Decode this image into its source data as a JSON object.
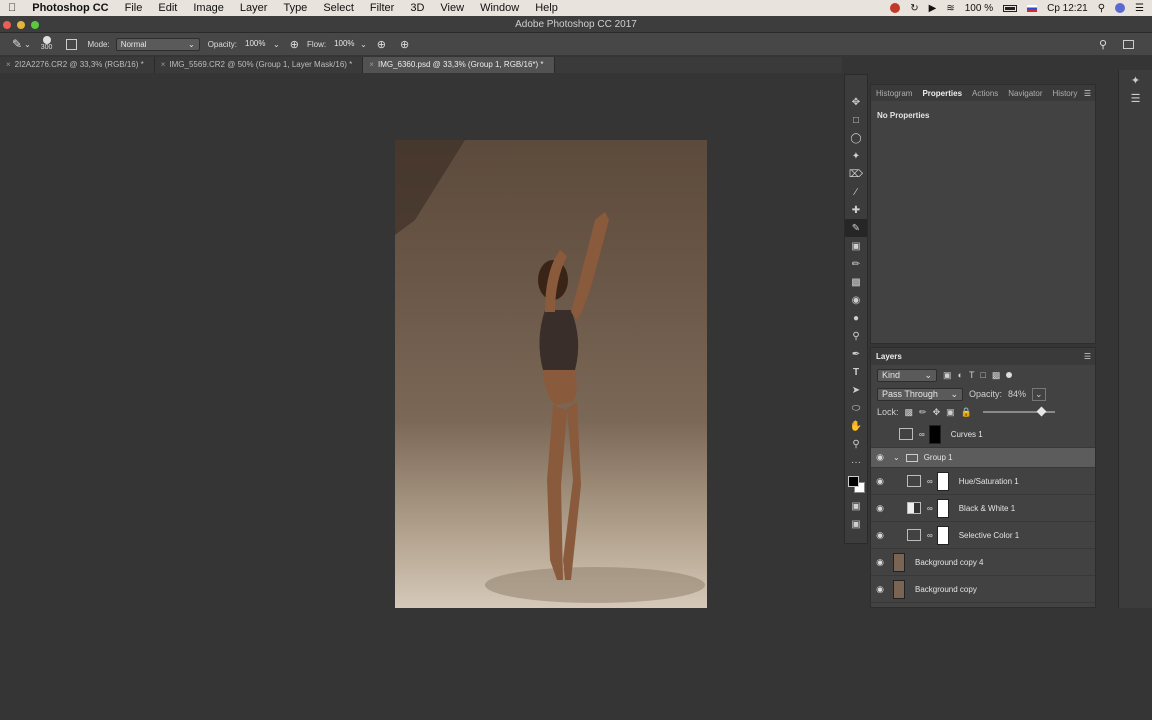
{
  "menubar": {
    "app": "Photoshop CC",
    "items": [
      "File",
      "Edit",
      "Image",
      "Layer",
      "Type",
      "Select",
      "Filter",
      "3D",
      "View",
      "Window",
      "Help"
    ],
    "battery": "100 %",
    "clock": "Ср 12:21"
  },
  "window": {
    "title": "Adobe Photoshop CC 2017"
  },
  "options": {
    "brush_size": "300",
    "mode_label": "Mode:",
    "mode_value": "Normal",
    "opacity_label": "Opacity:",
    "opacity_value": "100%",
    "flow_label": "Flow:",
    "flow_value": "100%"
  },
  "tabs": [
    {
      "label": "2I2A2276.CR2 @ 33,3% (RGB/16) *",
      "active": false
    },
    {
      "label": "IMG_5569.CR2 @ 50% (Group 1, Layer Mask/16) *",
      "active": false
    },
    {
      "label": "IMG_6360.psd @ 33,3% (Group 1, RGB/16*) *",
      "active": true
    }
  ],
  "properties_panel": {
    "tabs": [
      "Histogram",
      "Properties",
      "Actions",
      "Navigator",
      "History"
    ],
    "active_tab": "Properties",
    "content": "No Properties"
  },
  "layers_panel": {
    "title": "Layers",
    "filter_kind": "Kind",
    "blend_mode": "Pass Through",
    "opacity_label": "Opacity:",
    "opacity_value": "84%",
    "lock_label": "Lock:",
    "layers": [
      {
        "name": "Curves 1",
        "visible": false,
        "type": "adjustment",
        "mask": "black"
      },
      {
        "name": "Group 1",
        "visible": true,
        "type": "group",
        "selected": true
      },
      {
        "name": "Hue/Saturation 1",
        "visible": true,
        "type": "adjustment",
        "mask": "white"
      },
      {
        "name": "Black & White 1",
        "visible": true,
        "type": "adjustment",
        "mask": "white"
      },
      {
        "name": "Selective Color 1",
        "visible": true,
        "type": "adjustment",
        "mask": "white"
      },
      {
        "name": "Background copy 4",
        "visible": true,
        "type": "pixel"
      },
      {
        "name": "Background copy",
        "visible": true,
        "type": "pixel"
      }
    ]
  },
  "colors": {
    "foreground": "#000000",
    "background": "#ffffff"
  }
}
